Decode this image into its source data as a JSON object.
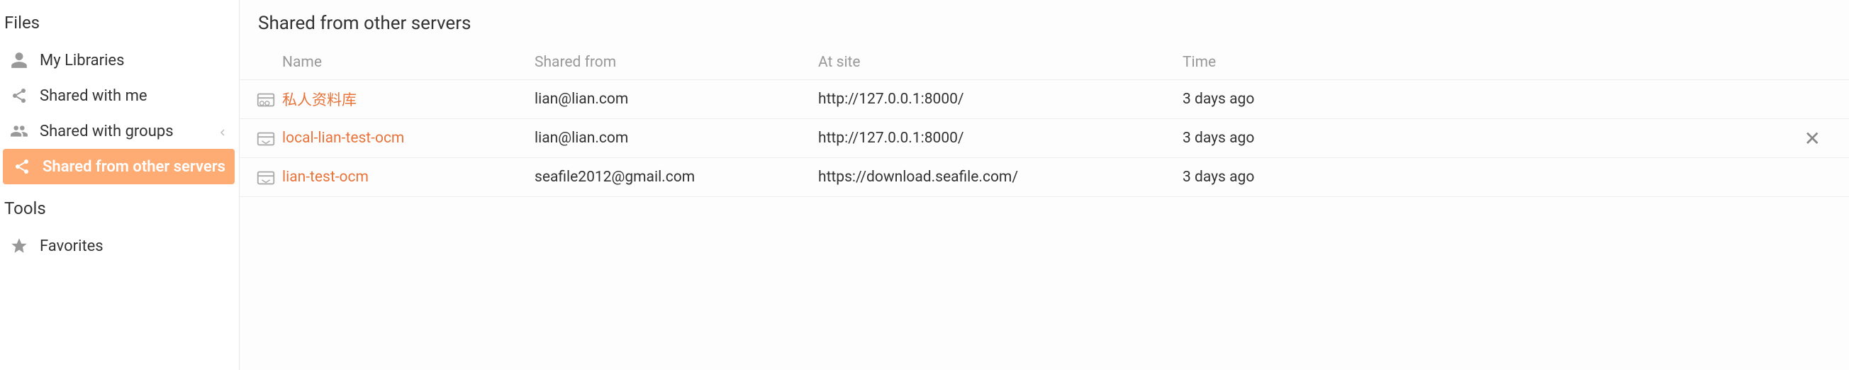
{
  "sidebar": {
    "sections": [
      {
        "title": "Files",
        "items": [
          {
            "label": "My Libraries",
            "active": false
          },
          {
            "label": "Shared with me",
            "active": false
          },
          {
            "label": "Shared with groups",
            "active": false,
            "expandable": true
          },
          {
            "label": "Shared from other servers",
            "active": true
          }
        ]
      },
      {
        "title": "Tools",
        "items": [
          {
            "label": "Favorites",
            "active": false
          }
        ]
      }
    ]
  },
  "main": {
    "title": "Shared from other servers",
    "columns": {
      "name": "Name",
      "shared_from": "Shared from",
      "at_site": "At site",
      "time": "Time"
    },
    "rows": [
      {
        "name": "私人资料库",
        "shared_from": "lian@lian.com",
        "at_site": "http://127.0.0.1:8000/",
        "time": "3 days ago",
        "readonly": true,
        "hover": false
      },
      {
        "name": "local-lian-test-ocm",
        "shared_from": "lian@lian.com",
        "at_site": "http://127.0.0.1:8000/",
        "time": "3 days ago",
        "readonly": false,
        "hover": true
      },
      {
        "name": "lian-test-ocm",
        "shared_from": "seafile2012@gmail.com",
        "at_site": "https://download.seafile.com/",
        "time": "3 days ago",
        "readonly": false,
        "hover": false
      }
    ]
  },
  "colors": {
    "accent": "#e8743b",
    "active_bg": "#feac74",
    "text": "#333333",
    "muted": "#999999"
  }
}
